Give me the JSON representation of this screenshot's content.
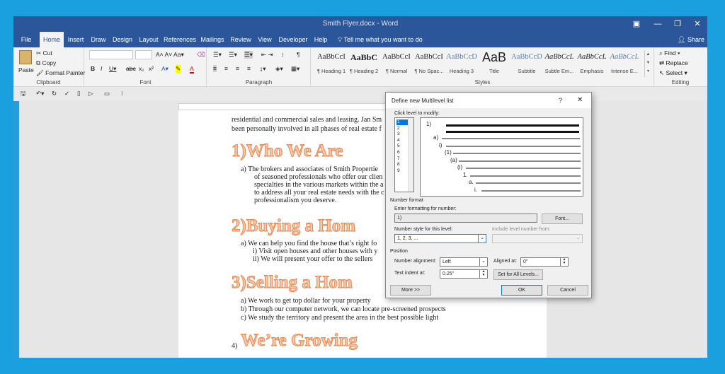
{
  "window": {
    "title": "Smith Flyer.docx  -  Word"
  },
  "tabs": [
    "File",
    "Home",
    "Insert",
    "Draw",
    "Design",
    "Layout",
    "References",
    "Mailings",
    "Review",
    "View",
    "Developer",
    "Help"
  ],
  "tellme": "Tell me what you want to do",
  "share": "Share",
  "clipboard": {
    "paste": "Paste",
    "cut": "Cut",
    "copy": "Copy",
    "format_painter": "Format Painter",
    "label": "Clipboard"
  },
  "font": {
    "label": "Font"
  },
  "paragraph": {
    "label": "Paragraph"
  },
  "styles": {
    "label": "Styles",
    "items": [
      {
        "preview": "AaBbCcI",
        "name": "¶ Heading 1"
      },
      {
        "preview": "AaBbC",
        "name": "¶ Heading 2"
      },
      {
        "preview": "AaBbCcI",
        "name": "¶ Normal"
      },
      {
        "preview": "AaBbCcI",
        "name": "¶ No Spac..."
      },
      {
        "preview": "AaBbCcD",
        "name": "Heading 3"
      },
      {
        "preview": "AaB",
        "name": "Title"
      },
      {
        "preview": "AaBbCcD",
        "name": "Subtitle"
      },
      {
        "preview": "AaBbCcL",
        "name": "Subtle Em..."
      },
      {
        "preview": "AaBbCcL",
        "name": "Emphasis"
      },
      {
        "preview": "AaBbCcL",
        "name": "Intense E..."
      }
    ]
  },
  "editing": {
    "find": "Find",
    "replace": "Replace",
    "select": "Select",
    "label": "Editing"
  },
  "document": {
    "intro1": "residential and commercial sales and leasing. Jan Sm",
    "intro2": "been personally involved in all phases of real estate f",
    "h1": "1)Who We Are",
    "p1": [
      "a)    The brokers and associates of Smith Propertie",
      "of seasoned professionals who offer our clien",
      "specialties in the various markets within the a",
      "to address all your real estate needs with the c",
      "professionalism you deserve."
    ],
    "h2": "2)Buying a Hom",
    "p2": [
      "a)    We can help you find the house that’s right fo",
      "i)     Visit open houses and other houses with y",
      "ii)    We will present your offer to the sellers"
    ],
    "h3": "3)Selling a Hom",
    "p3": [
      "a)    We work to get top dollar for your property",
      "b)    Through our computer network, we can locate pre-screened prospects",
      "c)    We study the territory and present the area in the best possible light"
    ],
    "h4_num": "4)",
    "h4": "We’re Growing"
  },
  "dialog": {
    "title": "Define new Multilevel list",
    "help": "?",
    "click_level": "Click level to modify:",
    "levels": [
      "1",
      "2",
      "3",
      "4",
      "5",
      "6",
      "7",
      "8",
      "9"
    ],
    "preview_labels": [
      "1)",
      "a)",
      "i)",
      "(1)",
      "(a)",
      "(i)",
      "1.",
      "a.",
      "i."
    ],
    "number_format": "Number format",
    "enter_formatting": "Enter formatting for number:",
    "format_value": "1)",
    "font_btn": "Font...",
    "number_style": "Number style for this level:",
    "number_style_value": "1, 2, 3, ...",
    "include_level": "Include level number from:",
    "position": "Position",
    "number_alignment": "Number alignment:",
    "alignment_value": "Left",
    "aligned_at": "Aligned at:",
    "aligned_value": "0\"",
    "text_indent": "Text indent at:",
    "indent_value": "0.25\"",
    "set_all": "Set for All Levels...",
    "more": "More >>",
    "ok": "OK",
    "cancel": "Cancel"
  }
}
